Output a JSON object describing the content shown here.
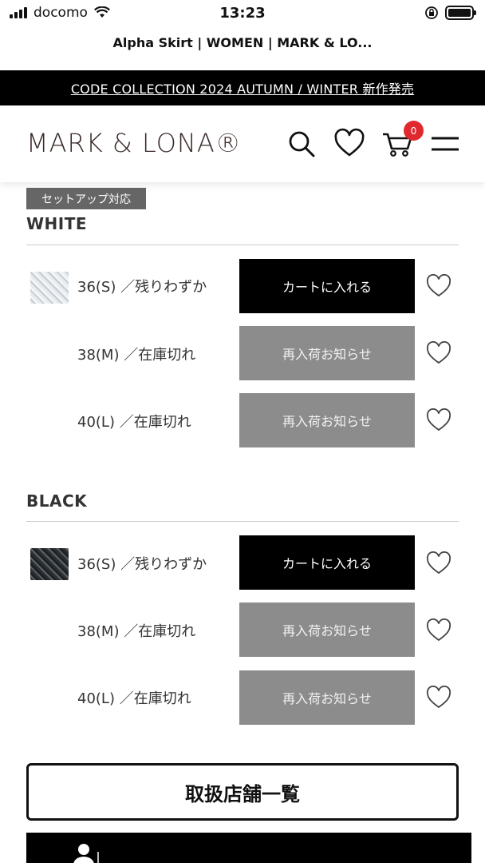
{
  "status_bar": {
    "carrier": "docomo",
    "time": "13:23"
  },
  "browser": {
    "title": "Alpha Skirt | WOMEN | MARK & LO..."
  },
  "promo": {
    "text": "CODE COLLECTION 2024 AUTUMN / WINTER 新作発売"
  },
  "header": {
    "logo": "MARK & LONA®",
    "cart_count": "0"
  },
  "setup_tag": "セットアップ対応",
  "colors": [
    {
      "name": "WHITE",
      "rows": [
        {
          "size": "36(S) ／残りわずか",
          "action": "カートに入れる",
          "type": "cart"
        },
        {
          "size": "38(M) ／在庫切れ",
          "action": "再入荷お知らせ",
          "type": "restock"
        },
        {
          "size": "40(L) ／在庫切れ",
          "action": "再入荷お知らせ",
          "type": "restock"
        }
      ]
    },
    {
      "name": "BLACK",
      "rows": [
        {
          "size": "36(S) ／残りわずか",
          "action": "カートに入れる",
          "type": "cart"
        },
        {
          "size": "38(M) ／在庫切れ",
          "action": "再入荷お知らせ",
          "type": "restock"
        },
        {
          "size": "40(L) ／在庫切れ",
          "action": "再入荷お知らせ",
          "type": "restock"
        }
      ]
    }
  ],
  "store_list_button": "取扱店舗一覧",
  "colors_theme": {
    "cart_button": "#000000",
    "restock_button": "#8c8c8c",
    "badge": "#e0292f"
  }
}
